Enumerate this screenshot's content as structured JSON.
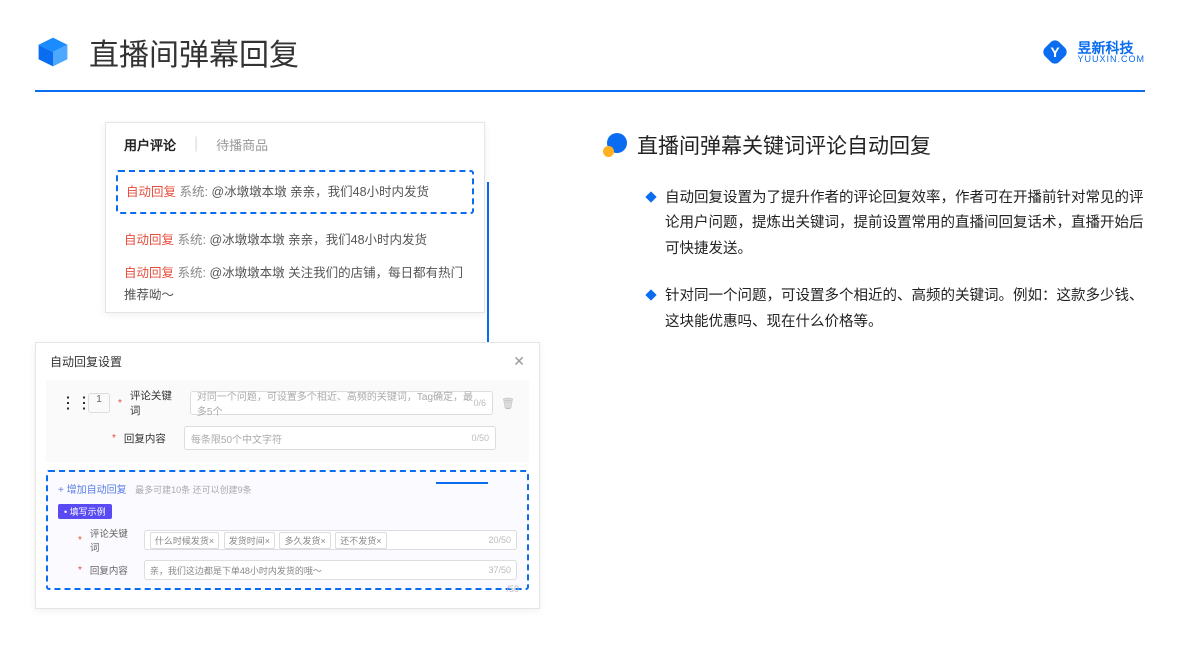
{
  "header": {
    "title": "直播间弹幕回复",
    "brand_cn": "昱新科技",
    "brand_en": "YUUXIN.COM"
  },
  "comments": {
    "tab_active": "用户评论",
    "tab_inactive": "待播商品",
    "auto_label": "自动回复",
    "sys_prefix": "系统:",
    "row1": "@冰墩墩本墩 亲亲，我们48小时内发货",
    "row2": "@冰墩墩本墩 亲亲，我们48小时内发货",
    "row3": "@冰墩墩本墩 关注我们的店铺，每日都有热门推荐呦～"
  },
  "settings": {
    "title": "自动回复设置",
    "close": "✕",
    "idx": "1",
    "kw_label": "评论关键词",
    "kw_placeholder": "对同一个问题，可设置多个相近、高频的关键词，Tag确定，最多5个",
    "kw_counter": "0/6",
    "content_label": "回复内容",
    "content_placeholder": "每条限50个中文字符",
    "content_counter": "0/50",
    "add_text": "+ 增加自动回复",
    "add_hint": "最多可建10条 还可以创建9条",
    "badge": "• 填写示例",
    "ex_kw_label": "评论关键词",
    "ex_tags": [
      "什么时候发货×",
      "发货时间×",
      "多久发货×",
      "还不发货×"
    ],
    "ex_kw_counter": "20/50",
    "ex_content_label": "回复内容",
    "ex_content_value": "亲，我们这边都是下单48小时内发货的哦～",
    "ex_content_counter": "37/50",
    "outer_counter": "/50"
  },
  "right": {
    "section_title": "直播间弹幕关键词评论自动回复",
    "bullet1": "自动回复设置为了提升作者的评论回复效率，作者可在开播前针对常见的评论用户问题，提炼出关键词，提前设置常用的直播间回复话术，直播开始后可快捷发送。",
    "bullet2": "针对同一个问题，可设置多个相近的、高频的关键词。例如：这款多少钱、这块能优惠吗、现在什么价格等。"
  }
}
